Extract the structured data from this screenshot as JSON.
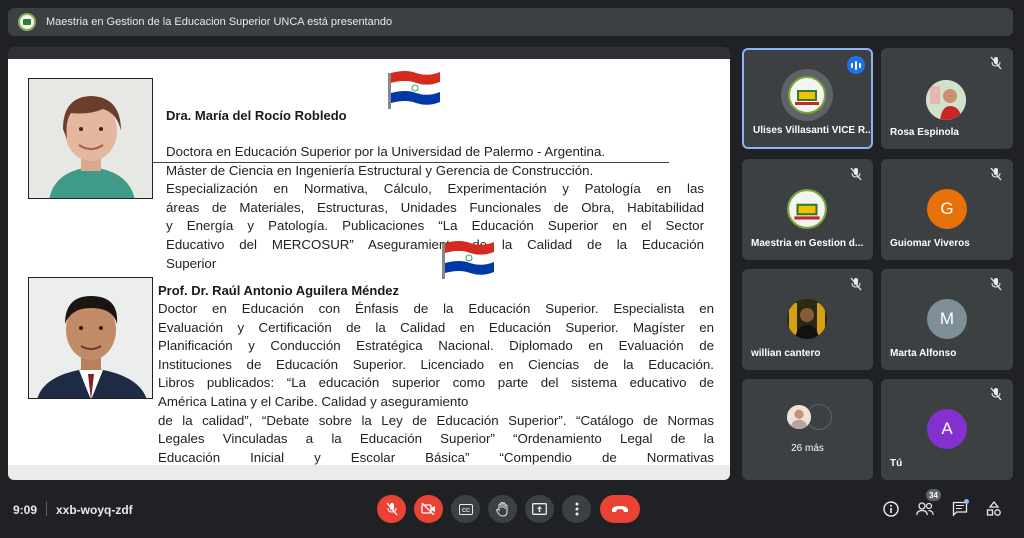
{
  "presenting": {
    "text": "Maestria en Gestion de la Educacion Superior UNCA está presentando"
  },
  "slide": {
    "person1": {
      "name": "Dra. María del Rocío Robledo",
      "bio": [
        "Doctora en Educación Superior por la Universidad de Palermo - Argentina.",
        "Máster de Ciencia en Ingeniería Estructural y Gerencia de Construcción.",
        "Especialización en Normativa, Cálculo, Experimentación y Patología en las",
        "áreas de Materiales, Estructuras, Unidades Funcionales de Obra, Habitabilidad",
        "y Energía y Patología. Publicaciones “La Educación Superior en el Sector",
        "Educativo del MERCOSUR” Aseguramiento de la Calidad de la Educación",
        "Superior"
      ]
    },
    "person2": {
      "name": "Prof. Dr. Raúl Antonio Aguilera Méndez",
      "bio": [
        "Doctor en Educación con Énfasis de la Educación Superior. Especialista en",
        "Evaluación y Certificación de la Calidad en Educación Superior. Magíster en",
        "Planificación y Conducción Estratégica Nacional. Diplomado en Evaluación de",
        "Instituciones de Educación Superior. Licenciado en Ciencias de la Educación.",
        "Libros publicados: “La educación superior como parte del sistema educativo de",
        "América Latina y el Caribe. Calidad y aseguramiento",
        "de la calidad”, “Debate sobre la Ley de Educación Superior”. “Catálogo de Normas",
        "Legales Vinculadas a la Educación Superior” “Ordenamiento Legal de la",
        "Educación Inicial y Escolar Básica” “Compendio de Normativas"
      ]
    }
  },
  "participants": [
    {
      "name": "Ulises Villasanti VICE R...",
      "avatar": "university-logo",
      "speaking": true
    },
    {
      "name": "Rosa Espinola",
      "avatar": "photo",
      "muted": true
    },
    {
      "name": "Maestria en Gestion d...",
      "avatar": "university-logo",
      "muted": true
    },
    {
      "name": "Guiomar Viveros",
      "letter": "G",
      "color": "#e8710a",
      "muted": true
    },
    {
      "name": "willian cantero",
      "avatar": "photo",
      "muted": true
    },
    {
      "name": "Marta Alfonso",
      "letter": "M",
      "color": "#7e8f97",
      "muted": true
    },
    {
      "name": "26 más",
      "avatar": "group"
    },
    {
      "name": "Tú",
      "letter": "A",
      "color": "#8430ce",
      "muted": true
    }
  ],
  "meeting": {
    "time": "9:09",
    "code": "xxb-woyq-zdf",
    "people_count": "34"
  },
  "colors": {
    "red": "#ea4335",
    "accent": "#8ab4f8",
    "bar": "#3c4043",
    "background": "#202124"
  }
}
